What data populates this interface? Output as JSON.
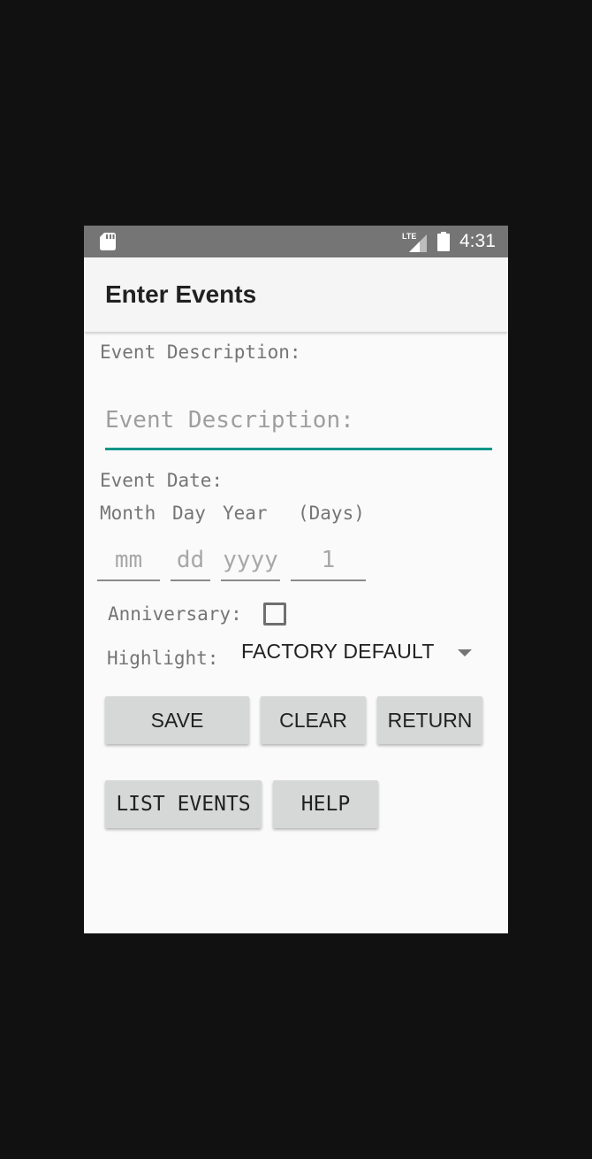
{
  "status_bar": {
    "time": "4:31",
    "icons": [
      "sd-card-icon",
      "lte-signal-icon",
      "battery-icon"
    ],
    "lte_label": "LTE"
  },
  "app_bar": {
    "title": "Enter Events"
  },
  "form": {
    "description_label": "Event Description:",
    "description_placeholder": "Event Description:",
    "description_value": "",
    "date_label": "Event Date:",
    "month_label": "Month",
    "day_label": "Day",
    "year_label": "Year",
    "days_label": "(Days)",
    "month_placeholder": "mm",
    "day_placeholder": "dd",
    "year_placeholder": "yyyy",
    "days_placeholder": "1",
    "anniversary_label": "Anniversary:",
    "anniversary_checked": false,
    "highlight_label": "Highlight:",
    "highlight_selected": "FACTORY DEFAULT"
  },
  "buttons": {
    "save": "SAVE",
    "clear": "CLEAR",
    "return": "RETURN",
    "list_events": "LIST EVENTS",
    "help": "HELP"
  },
  "colors": {
    "accent": "#009688",
    "status_bar": "#757575",
    "app_bar": "#f5f5f5",
    "button": "#d6d7d7",
    "screen_bg": "#fafafa",
    "outer_bg": "#111111"
  }
}
